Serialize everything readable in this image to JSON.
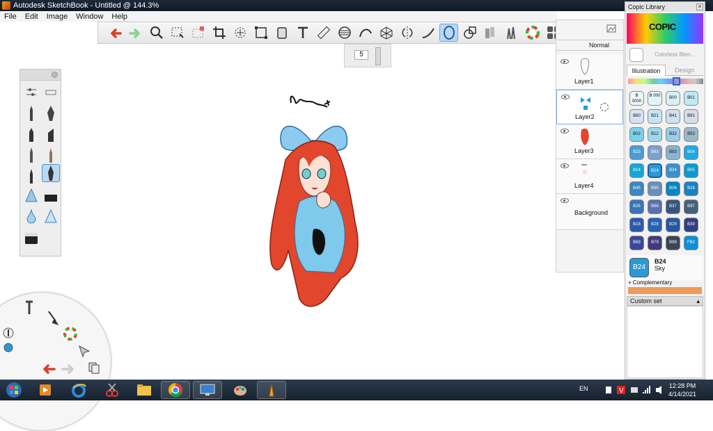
{
  "window": {
    "title": "Autodesk SketchBook - Untitled @ 144.3%"
  },
  "menu": [
    "File",
    "Edit",
    "Image",
    "Window",
    "Help"
  ],
  "toolbar": {
    "icons": [
      "undo-icon",
      "redo-icon",
      "zoom-icon",
      "select-icon",
      "crop-select-icon",
      "crop-icon",
      "lasso-icon",
      "distort-icon",
      "bucket-icon",
      "text-icon",
      "ruler-icon",
      "ellipse-guide-icon",
      "curve-icon",
      "perspective-icon",
      "symmetry-icon",
      "stroke-icon",
      "ellipse-icon",
      "shape-icon",
      "copic-markers-icon",
      "brush-set-icon",
      "color-wheel-icon",
      "palette-icon"
    ],
    "brush_size": "5"
  },
  "layers": {
    "blend_mode": "Normal",
    "items": [
      {
        "name": "Layer1"
      },
      {
        "name": "Layer2"
      },
      {
        "name": "Layer3"
      },
      {
        "name": "Layer4"
      },
      {
        "name": "Background"
      }
    ]
  },
  "copic": {
    "title": "Copic Library",
    "logo_text": "COPIC",
    "colorless": "Colorless Blen...",
    "tabs": [
      "Illustration",
      "Design"
    ],
    "swatches": [
      {
        "code": "B 0000",
        "color": "#eaf6f6"
      },
      {
        "code": "B 000",
        "color": "#e2f4f6"
      },
      {
        "code": "B00",
        "color": "#d6f0f4"
      },
      {
        "code": "B01",
        "color": "#bfe9f2"
      },
      {
        "code": "B60",
        "color": "#d7e3f1"
      },
      {
        "code": "B21",
        "color": "#c6e4f4"
      },
      {
        "code": "B41",
        "color": "#cfe1ee"
      },
      {
        "code": "B91",
        "color": "#d5dde6"
      },
      {
        "code": "B02",
        "color": "#7cd0ec"
      },
      {
        "code": "B12",
        "color": "#9fd7ee"
      },
      {
        "code": "B32",
        "color": "#99cde8"
      },
      {
        "code": "B52",
        "color": "#9cb8c8"
      },
      {
        "code": "B23",
        "color": "#4b9bd2"
      },
      {
        "code": "B63",
        "color": "#7f9fcc"
      },
      {
        "code": "B93",
        "color": "#8ab3cf"
      },
      {
        "code": "B04",
        "color": "#20a9dc"
      },
      {
        "code": "B14",
        "color": "#16a6d8"
      },
      {
        "code": "B24",
        "color": "#2a9ad6"
      },
      {
        "code": "B34",
        "color": "#3a91c9"
      },
      {
        "code": "B05",
        "color": "#0f97d0"
      },
      {
        "code": "B45",
        "color": "#3d86be"
      },
      {
        "code": "B95",
        "color": "#6a8fb8"
      },
      {
        "code": "B06",
        "color": "#0884c2"
      },
      {
        "code": "B16",
        "color": "#1b82c0"
      },
      {
        "code": "B26",
        "color": "#3a74b6"
      },
      {
        "code": "B66",
        "color": "#5b6fae"
      },
      {
        "code": "B37",
        "color": "#35557e"
      },
      {
        "code": "B97",
        "color": "#45617a"
      },
      {
        "code": "B18",
        "color": "#2c5aa8"
      },
      {
        "code": "B28",
        "color": "#2462b2"
      },
      {
        "code": "B29",
        "color": "#25579e"
      },
      {
        "code": "B39",
        "color": "#2f3f80"
      },
      {
        "code": "B69",
        "color": "#3b4796"
      },
      {
        "code": "B79",
        "color": "#41397e"
      },
      {
        "code": "B99",
        "color": "#3b4554"
      },
      {
        "code": "FB2",
        "color": "#0c8fd6"
      }
    ],
    "selected": {
      "code": "B24",
      "name": "Sky",
      "color": "#2a9ad6"
    },
    "complementary": "+ Complementary",
    "custom_set": "Custom set"
  },
  "taskbar": {
    "lang": "EN",
    "time": "12:28 PM",
    "date": "4/14/2021",
    "apps": [
      "start",
      "media-player",
      "internet-explorer",
      "snipping-tool",
      "file-explorer",
      "chrome",
      "remote-desktop",
      "paint",
      "sketchbook"
    ]
  }
}
